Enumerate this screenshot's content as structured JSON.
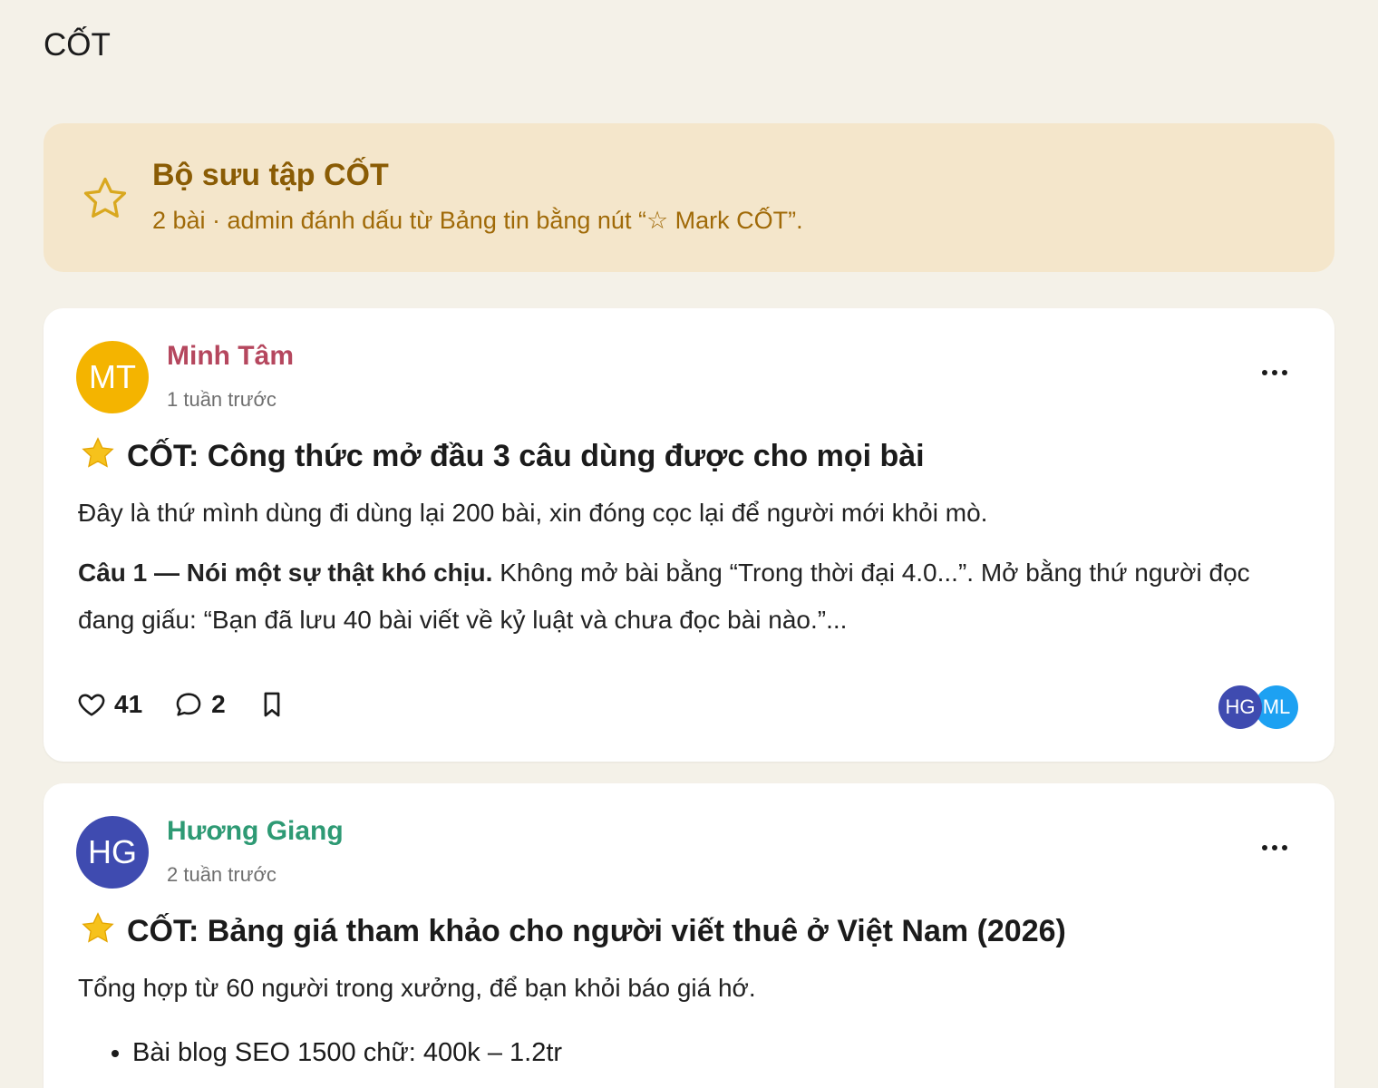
{
  "page": {
    "title": "CỐT"
  },
  "banner": {
    "title": "Bộ sưu tập CỐT",
    "subtitle": "2 bài · admin đánh dấu từ Bảng tin bằng nút “☆ Mark CỐT”.",
    "icon": "star-outline-icon",
    "accent": "#d9a81f"
  },
  "posts": [
    {
      "avatar_initials": "MT",
      "avatar_color": "#f4b400",
      "author": "Minh Tâm",
      "author_color": "#b5475e",
      "time": "1 tuần trước",
      "title": "CỐT: Công thức mở đầu 3 câu dùng được cho mọi bài",
      "intro": "Đây là thứ mình dùng đi dùng lại 200 bài, xin đóng cọc lại để người mới khỏi mò.",
      "body_bold": "Câu 1 — Nói một sự thật khó chịu.",
      "body_rest": " Không mở bài bằng “Trong thời đại 4.0...”. Mở bằng thứ người đọc đang giấu: “Bạn đã lưu 40 bài viết về kỷ luật và chưa đọc bài nào.”...",
      "likes": "41",
      "comments": "2",
      "reactors": [
        {
          "initials": "HG",
          "color": "#3f4bb0"
        },
        {
          "initials": "ML",
          "color": "#1da1f2"
        }
      ]
    },
    {
      "avatar_initials": "HG",
      "avatar_color": "#3f4bb0",
      "author": "Hương Giang",
      "author_color": "#2e9a74",
      "time": "2 tuần trước",
      "title": "CỐT: Bảng giá tham khảo cho người viết thuê ở Việt Nam (2026)",
      "intro": "Tổng hợp từ 60 người trong xưởng, để bạn khỏi báo giá hớ.",
      "bullets": [
        "Bài blog SEO 1500 chữ: 400k – 1.2tr"
      ]
    }
  ]
}
